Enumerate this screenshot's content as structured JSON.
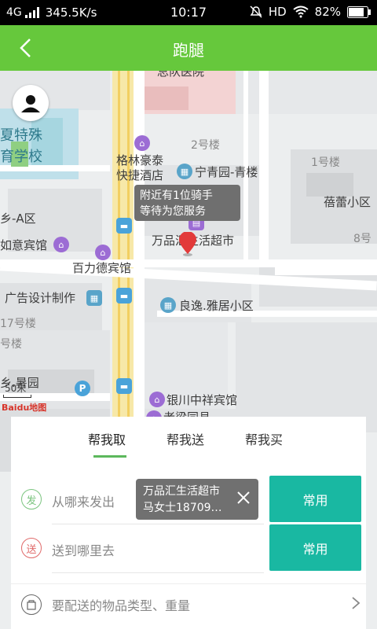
{
  "status_bar": {
    "network": "4G",
    "speed": "345.5K/s",
    "time": "10:17",
    "hd": "HD",
    "battery": "82%"
  },
  "header": {
    "title": "跑腿"
  },
  "map": {
    "tooltip": {
      "line1": "附近有1位骑手",
      "line2": "等待为您服务"
    },
    "labels": {
      "hospital": "总队医院",
      "school1": "夏特殊",
      "school2": "育学校",
      "hotel1a": "格林豪泰",
      "hotel1b": "快捷酒店",
      "yuqing": "宁青园-青楼",
      "b2": "2号楼",
      "b1": "1号楼",
      "beilei": "蓓蕾小区",
      "xiangA": "乡-A区",
      "ruyi": "如意宾馆",
      "wanpin": "万品汇生活超市",
      "baili": "百力德宾馆",
      "b8": "8号",
      "ad": "广告设计制作",
      "liangyi": "良逸.雅居小区",
      "b17": "17号楼",
      "blou": "号楼",
      "xiang2": "乡.暑园",
      "yinchuan": "银川中祥宾馆",
      "bottom": "老梁同县",
      "scale": "50米",
      "logo": "Baidu地图"
    },
    "poi_letter": "P"
  },
  "tabs": [
    "帮我取",
    "帮我送",
    "帮我买"
  ],
  "form": {
    "from_icon": "发",
    "from_placeholder": "从哪来发出",
    "to_icon": "送",
    "to_placeholder": "送到哪里去",
    "goods_placeholder": "要配送的物品类型、重量",
    "common_label": "常用"
  },
  "popup": {
    "line1": "万品汇生活超市",
    "line2": "马女士18709…"
  },
  "colors": {
    "header": "#66c83c",
    "accent": "#19b8a2",
    "tab_underline": "#5cb85c",
    "from": "#7bc47f",
    "to": "#e06a6a"
  }
}
